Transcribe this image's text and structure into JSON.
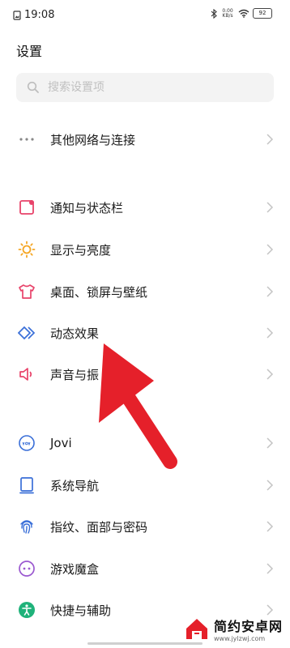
{
  "status": {
    "time": "19:08",
    "net_speed_value": "0.00",
    "net_speed_unit": "KB/s",
    "battery": "92"
  },
  "page": {
    "title": "设置"
  },
  "search": {
    "placeholder": "搜索设置项"
  },
  "items": [
    {
      "label": "其他网络与连接",
      "icon": "more-dots-icon",
      "color": "#888888"
    },
    {
      "label": "通知与状态栏",
      "icon": "notification-icon",
      "color": "#e8436a"
    },
    {
      "label": "显示与亮度",
      "icon": "sun-icon",
      "color": "#f5a623"
    },
    {
      "label": "桌面、锁屏与壁纸",
      "icon": "shirt-icon",
      "color": "#e8436a"
    },
    {
      "label": "动态效果",
      "icon": "diamond-icon",
      "color": "#3a6fd8"
    },
    {
      "label": "声音与振",
      "icon": "speaker-icon",
      "color": "#e8436a"
    },
    {
      "label": "Jovi",
      "icon": "jovi-icon",
      "color": "#3a6fd8"
    },
    {
      "label": "系统导航",
      "icon": "navigation-icon",
      "color": "#3a6fd8"
    },
    {
      "label": "指纹、面部与密码",
      "icon": "fingerprint-icon",
      "color": "#3a6fd8"
    },
    {
      "label": "游戏魔盒",
      "icon": "game-box-icon",
      "color": "#9b59d0"
    },
    {
      "label": "快捷与辅助",
      "icon": "accessibility-icon",
      "color": "#1fb27a"
    }
  ],
  "annotation": {
    "arrow_color": "#e5202a"
  },
  "watermark": {
    "name": "简约安卓网",
    "url": "www.jylzwj.com"
  }
}
